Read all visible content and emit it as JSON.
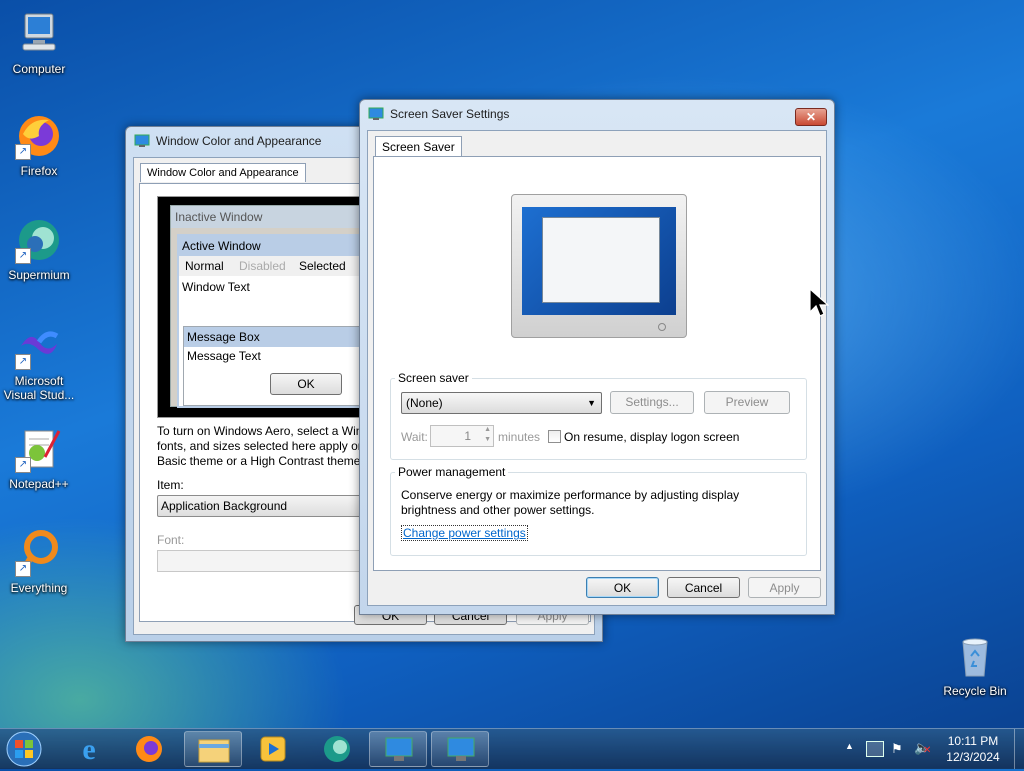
{
  "desktop": {
    "icons": [
      {
        "label": "Computer",
        "icon": "computer-icon"
      },
      {
        "label": "Firefox",
        "icon": "firefox-icon"
      },
      {
        "label": "Supermium",
        "icon": "supermium-icon"
      },
      {
        "label": "Microsoft Visual Stud...",
        "icon": "visual-studio-icon"
      },
      {
        "label": "Notepad++",
        "icon": "notepadpp-icon"
      },
      {
        "label": "Everything",
        "icon": "everything-icon"
      },
      {
        "label": "Recycle Bin",
        "icon": "recycle-bin-icon"
      }
    ]
  },
  "appearance_window": {
    "title": "Window Color and Appearance",
    "tab": "Window Color and Appearance",
    "preview": {
      "inactive": "Inactive Window",
      "active": "Active Window",
      "menu_normal": "Normal",
      "menu_disabled": "Disabled",
      "menu_selected": "Selected",
      "window_text": "Window Text",
      "message_box": "Message Box",
      "message_text": "Message Text",
      "ok": "OK"
    },
    "info_line1": "To turn on Windows Aero, select a Win",
    "info_line2": "fonts, and sizes selected here apply onl",
    "info_line3": "Basic theme or a High Contrast theme.",
    "item_label": "Item:",
    "item_value": "Application Background",
    "font_label": "Font:",
    "ok": "OK",
    "cancel": "Cancel",
    "apply": "Apply"
  },
  "screensaver_window": {
    "title": "Screen Saver Settings",
    "tab": "Screen Saver",
    "screen_saver_group": "Screen saver",
    "selected": "(None)",
    "settings_button": "Settings...",
    "preview_button": "Preview",
    "wait_label": "Wait:",
    "wait_value": "1",
    "minutes_label": "minutes",
    "resume_label": "On resume, display logon screen",
    "power_group": "Power management",
    "power_line1": "Conserve energy or maximize performance by adjusting display",
    "power_line2": "brightness and other power settings.",
    "power_link": "Change power settings",
    "ok": "OK",
    "cancel": "Cancel",
    "apply": "Apply"
  },
  "taskbar": {
    "time": "10:11 PM",
    "date": "12/3/2024"
  },
  "colors": {
    "link": "#0066cc",
    "selected_row": "#b8cde6"
  }
}
